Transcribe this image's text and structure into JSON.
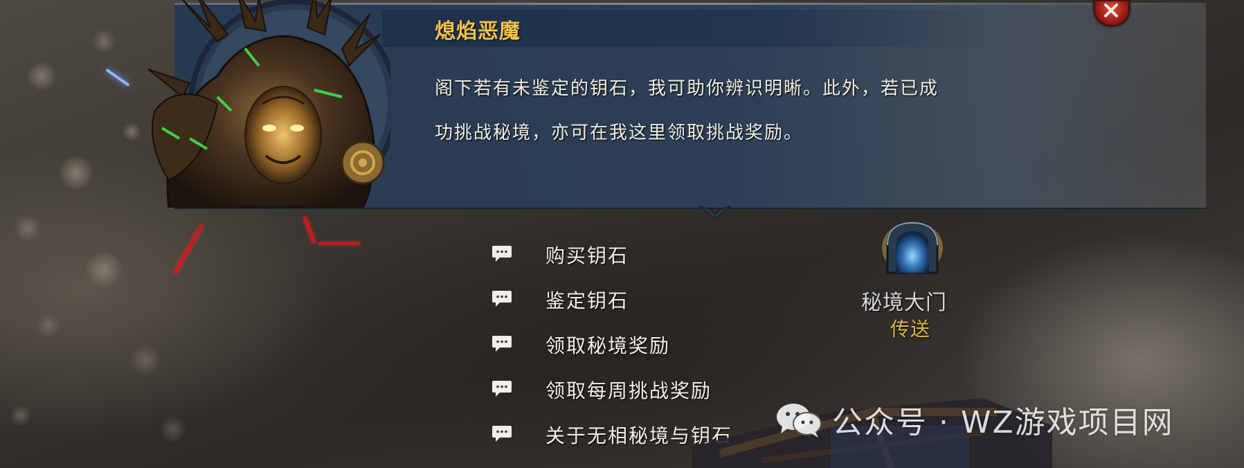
{
  "npc": {
    "name": "熄焰恶魔",
    "dialogue_line1": "阁下若有未鉴定的钥石，我可助你辨识明晰。此外，若已成",
    "dialogue_line2": "功挑战秘境，亦可在我这里领取挑战奖励。"
  },
  "options": [
    {
      "label": "购买钥石",
      "icon": "speech-bubble-icon"
    },
    {
      "label": "鉴定钥石",
      "icon": "speech-bubble-icon"
    },
    {
      "label": "领取秘境奖励",
      "icon": "speech-bubble-icon"
    },
    {
      "label": "领取每周挑战奖励",
      "icon": "speech-bubble-icon"
    },
    {
      "label": "关于无相秘境与钥石",
      "icon": "speech-bubble-icon"
    }
  ],
  "world_object": {
    "name": "秘境大门",
    "action": "传送",
    "icon": "portal-gate-icon"
  },
  "close_button": {
    "icon": "close-icon"
  },
  "watermark": {
    "text": "公众号 · WZ游戏项目网",
    "icon": "wechat-icon"
  },
  "colors": {
    "npc_name": "#f2c24a",
    "dialogue_text": "#f3efe4",
    "portal_action": "#d9b93a",
    "panel": "#2c4058",
    "close_button": "#c0281c"
  }
}
